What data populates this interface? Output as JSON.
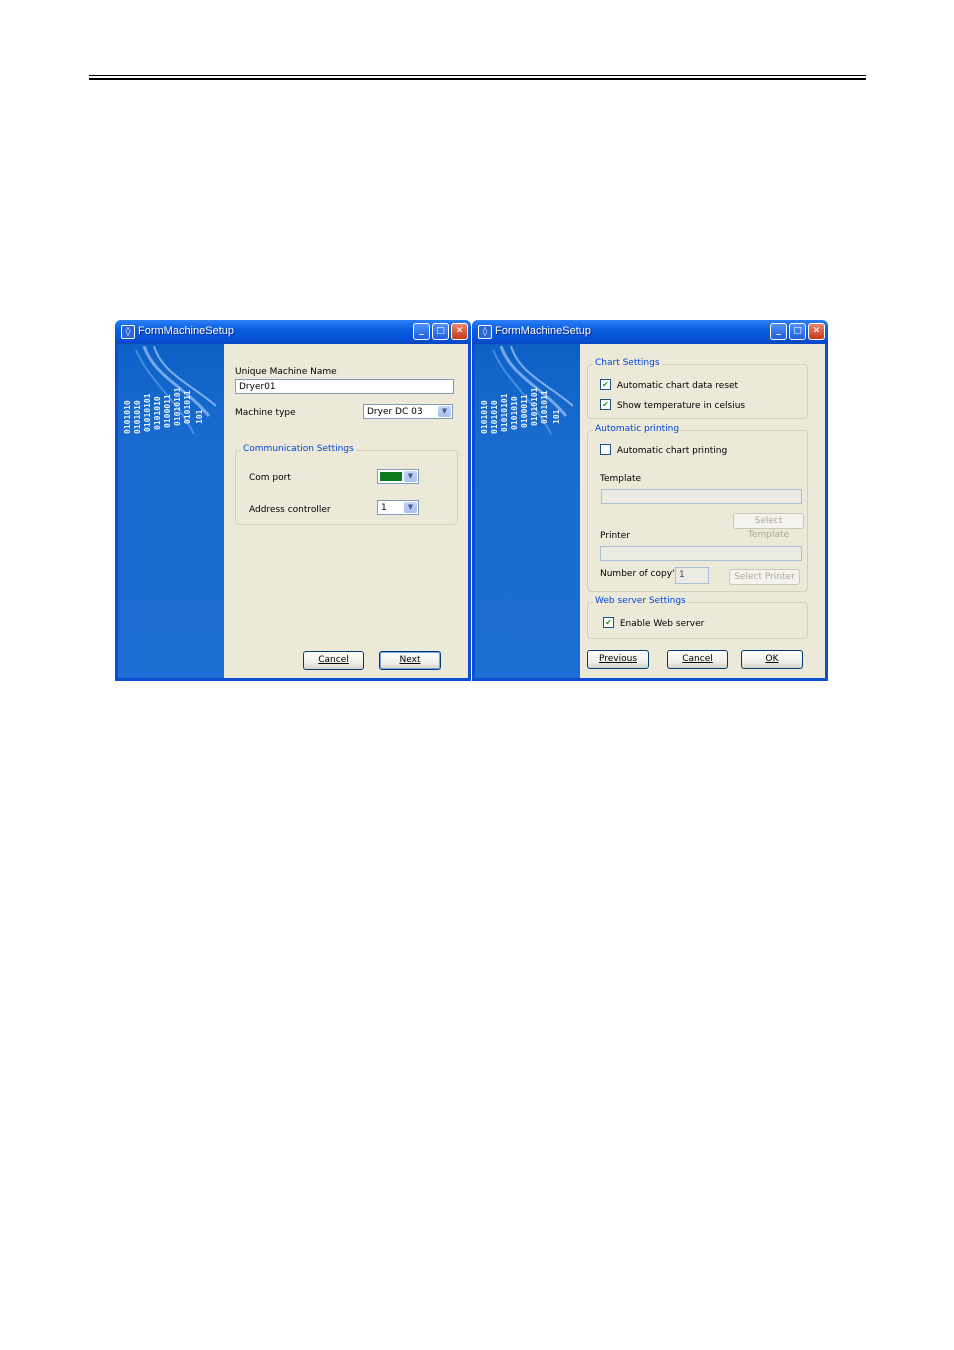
{
  "window1": {
    "title": "FormMachineSetup",
    "controls": {
      "minimize": "_",
      "maximize": "□",
      "close": "✕"
    },
    "machine_name_label": "Unique Machine Name",
    "machine_name_value": "Dryer01",
    "machine_type_label": "Machine type",
    "machine_type_value": "Dryer DC 03",
    "comm_group_title": "Communication Settings",
    "com_port_label": "Com port",
    "com_port_value_color": "#0d7a1e",
    "address_label": "Address controller",
    "address_value": "1",
    "cancel_label": "Cancel",
    "next_label": "Next"
  },
  "window2": {
    "title": "FormMachineSetup",
    "controls": {
      "minimize": "_",
      "maximize": "□",
      "close": "✕"
    },
    "chart_group_title": "Chart Settings",
    "auto_reset_label": "Automatic chart data reset",
    "auto_reset_checked": true,
    "show_celsius_label": "Show temperature in celsius",
    "show_celsius_checked": true,
    "printing_group_title": "Automatic printing",
    "auto_print_label": "Automatic chart printing",
    "auto_print_checked": false,
    "template_label": "Template",
    "template_value": "",
    "select_template_label": "Select Template",
    "printer_label": "Printer",
    "printer_value": "",
    "copies_label": "Number of copy's",
    "copies_value": "1",
    "select_printer_label": "Select Printer",
    "web_group_title": "Web server Settings",
    "enable_web_label": "Enable Web server",
    "enable_web_checked": true,
    "previous_label": "Previous",
    "cancel_label": "Cancel",
    "ok_label": "OK"
  },
  "side_panel_text": [
    "0101010",
    "0101010",
    "01010101",
    "0101010",
    "0100011",
    "01010101",
    "0101011",
    "101"
  ],
  "colors": {
    "titlebar": "#0a5ee0",
    "side_panel": "#1a6bd0",
    "dialog_bg": "#ece9d8",
    "group_title": "#0046d5"
  },
  "icons": [
    "app-icon",
    "minimize-icon",
    "maximize-icon",
    "close-icon",
    "dropdown-arrow-icon",
    "checkmark-icon"
  ]
}
